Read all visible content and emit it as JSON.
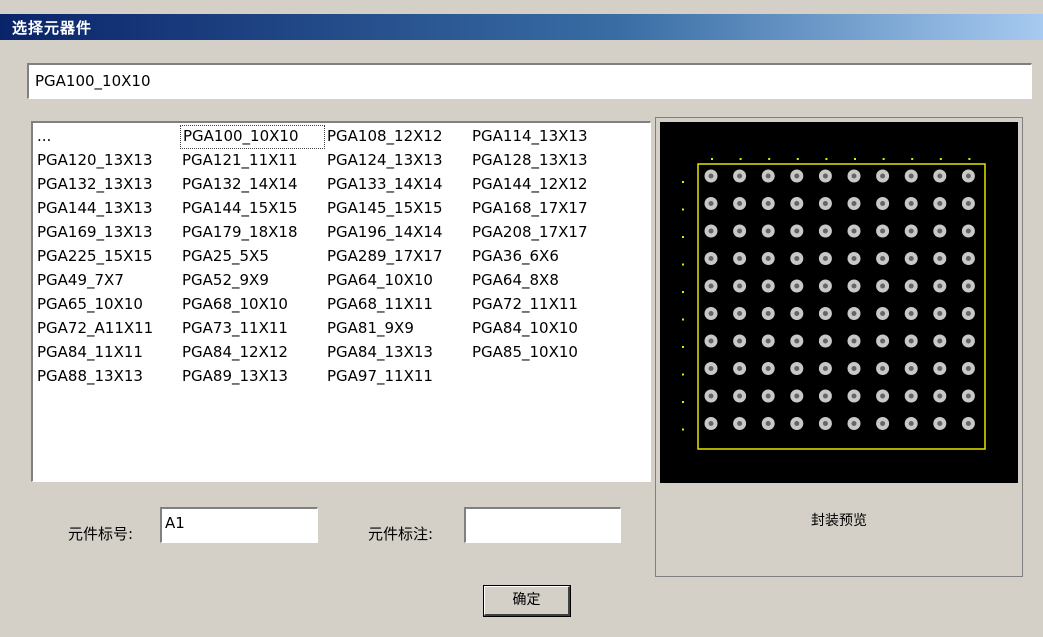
{
  "window": {
    "title": "选择元器件"
  },
  "selected_name": "PGA100_10X10",
  "component_list": {
    "items": [
      "...",
      "PGA100_10X10",
      "PGA108_12X12",
      "PGA114_13X13",
      "PGA120_13X13",
      "PGA121_11X11",
      "PGA124_13X13",
      "PGA128_13X13",
      "PGA132_13X13",
      "PGA132_14X14",
      "PGA133_14X14",
      "PGA144_12X12",
      "PGA144_13X13",
      "PGA144_15X15",
      "PGA145_15X15",
      "PGA168_17X17",
      "PGA169_13X13",
      "PGA179_18X18",
      "PGA196_14X14",
      "PGA208_17X17",
      "PGA225_15X15",
      "PGA25_5X5",
      "PGA289_17X17",
      "PGA36_6X6",
      "PGA49_7X7",
      "PGA52_9X9",
      "PGA64_10X10",
      "PGA64_8X8",
      "PGA65_10X10",
      "PGA68_10X10",
      "PGA68_11X11",
      "PGA72_11X11",
      "PGA72_A11X11",
      "PGA73_11X11",
      "PGA81_9X9",
      "PGA84_10X10",
      "PGA84_11X11",
      "PGA84_12X12",
      "PGA84_13X13",
      "PGA85_10X10",
      "PGA88_13X13",
      "PGA89_13X13",
      "PGA97_11X11"
    ],
    "selected_index": 1
  },
  "form": {
    "designator_label": "元件标号:",
    "designator_value": "A1",
    "comment_label": "元件标注:",
    "comment_value": ""
  },
  "preview": {
    "caption": "封装预览",
    "grid_rows": 10,
    "grid_cols": 10,
    "outline_color": "#e6e600",
    "pad_color": "#c8c8c8",
    "background_color": "#000000"
  },
  "buttons": {
    "ok_label": "确定"
  }
}
